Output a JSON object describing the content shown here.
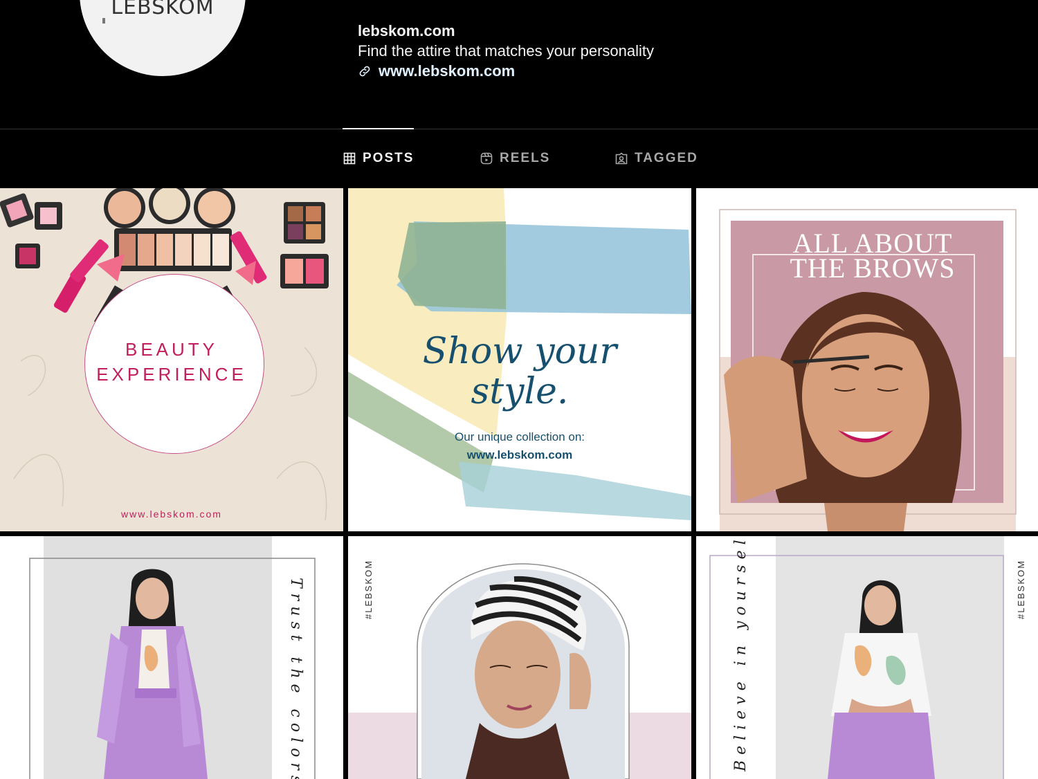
{
  "profile": {
    "avatar_text": "LEBSKOM",
    "username": "lebskom.com",
    "bio": "Find the attire that matches your personality",
    "link": "www.lebskom.com"
  },
  "tabs": [
    {
      "label": "POSTS",
      "icon": "grid-icon",
      "active": true
    },
    {
      "label": "REELS",
      "icon": "reels-icon",
      "active": false
    },
    {
      "label": "TAGGED",
      "icon": "tagged-icon",
      "active": false
    }
  ],
  "posts": [
    {
      "title_line1": "BEAUTY",
      "title_line2": "EXPERIENCE",
      "url": "www.lebskom.com"
    },
    {
      "script_line1": "Show your",
      "script_line2": "style.",
      "subtitle": "Our unique collection on:",
      "url": "www.lebskom.com"
    },
    {
      "title_line1": "ALL ABOUT",
      "title_line2": "THE BROWS"
    },
    {
      "side_text": "Trust the colors"
    },
    {
      "hashtag": "#LEBSKOM"
    },
    {
      "side_text": "Believe in yourself",
      "hashtag": "#LEBSKOM"
    }
  ],
  "colors": {
    "background": "#000000",
    "accent_pink": "#c21d5c",
    "link_blue": "#e0f1ff",
    "script_blue": "#16506e"
  }
}
